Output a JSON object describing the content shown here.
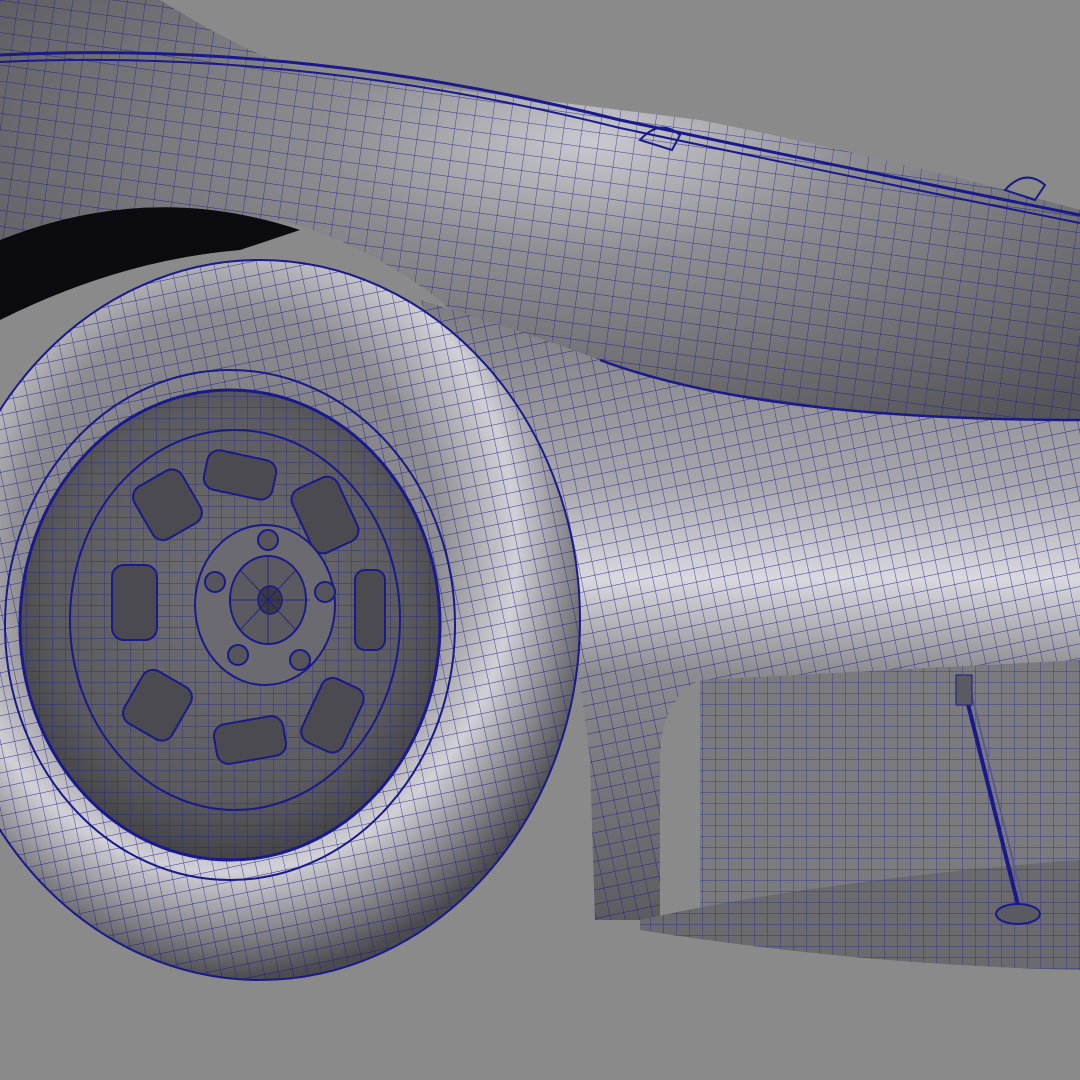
{
  "viewport": {
    "background_color": "#8a8a8a",
    "wire_color": "#1a1a8c"
  },
  "model": {
    "parts": [
      "body-shell",
      "front-fender",
      "wheel-arch",
      "tire",
      "wheel-rim",
      "hub",
      "lug-nuts",
      "fender-support-strut",
      "hood-latch"
    ]
  }
}
